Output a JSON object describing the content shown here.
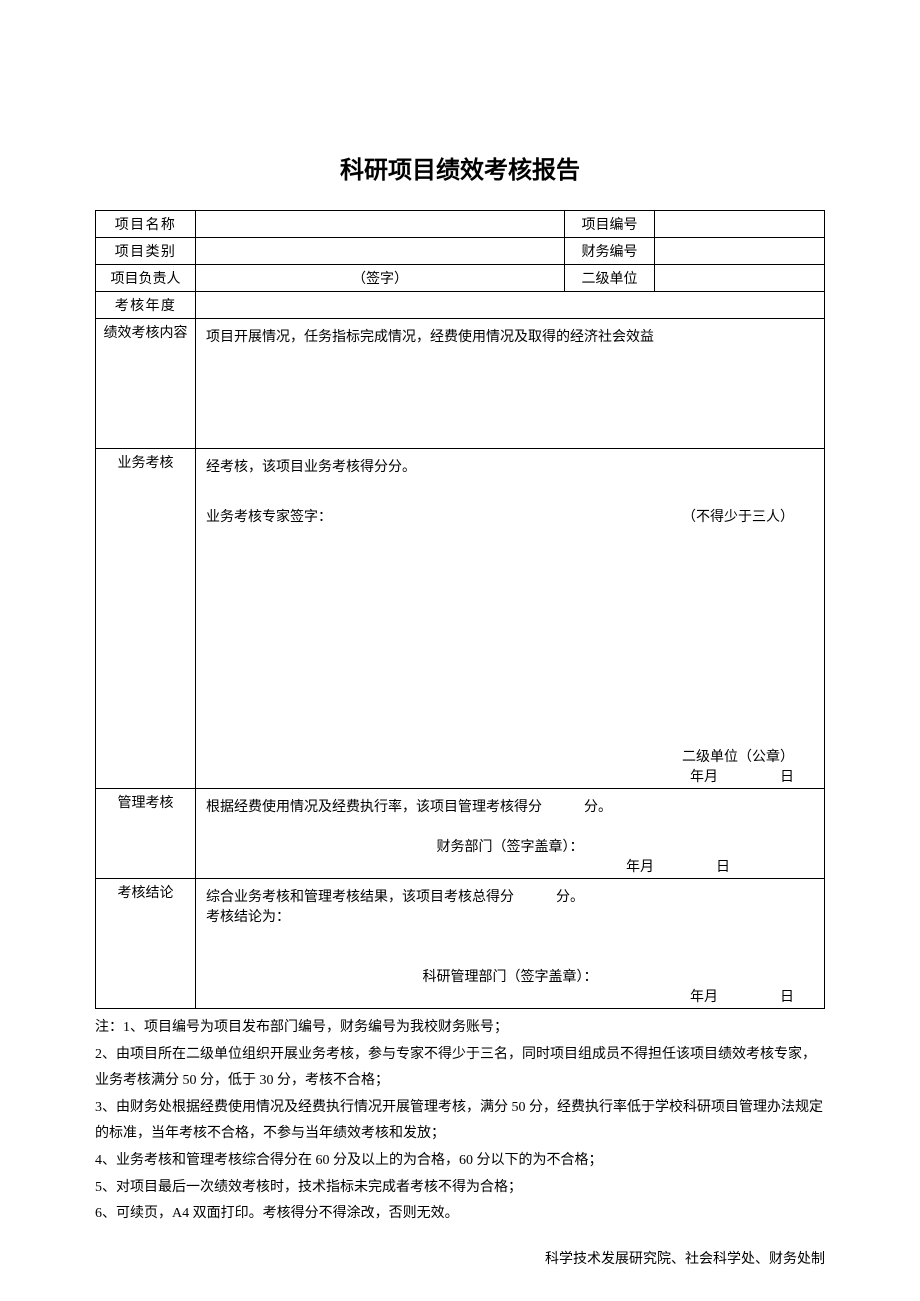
{
  "title": "科研项目绩效考核报告",
  "rows": {
    "r1": {
      "label1": "项目名称",
      "val1": "",
      "label2": "项目编号",
      "val2": ""
    },
    "r2": {
      "label1": "项目类别",
      "val1": "",
      "label2": "财务编号",
      "val2": ""
    },
    "r3": {
      "label1": "项目负责人",
      "val1": "（签字）",
      "label2": "二级单位",
      "val2": ""
    },
    "r4": {
      "label1": "考核年度",
      "val1": ""
    }
  },
  "assessContent": {
    "label": "绩效考核内容",
    "text": "项目开展情况，任务指标完成情况，经费使用情况及取得的经济社会效益"
  },
  "businessAssess": {
    "label": "业务考核",
    "line1": "经考核，该项目业务考核得分分。",
    "line2left": "业务考核专家签字：",
    "line2right": "（不得少于三人）",
    "stamp": "二级单位（公章）",
    "date_ym": "年月",
    "date_d": "日"
  },
  "mgmtAssess": {
    "label": "管理考核",
    "line1": "根据经费使用情况及经费执行率，该项目管理考核得分　　　分。",
    "line2": "财务部门（签字盖章）：",
    "date_ym": "年月",
    "date_d": "日"
  },
  "conclusion": {
    "label": "考核结论",
    "line1": "综合业务考核和管理考核结果，该项目考核总得分　　　分。",
    "line2": "考核结论为：",
    "line3": "科研管理部门（签字盖章）：",
    "date_ym": "年月",
    "date_d": "日"
  },
  "notes": {
    "n1": "注：1、项目编号为项目发布部门编号，财务编号为我校财务账号；",
    "n2": "2、由项目所在二级单位组织开展业务考核，参与专家不得少于三名，同时项目组成员不得担任该项目绩效考核专家，业务考核满分 50 分，低于 30 分，考核不合格；",
    "n3": "3、由财务处根据经费使用情况及经费执行情况开展管理考核，满分 50 分，经费执行率低于学校科研项目管理办法规定的标准，当年考核不合格，不参与当年绩效考核和发放；",
    "n4": "4、业务考核和管理考核综合得分在 60 分及以上的为合格，60 分以下的为不合格；",
    "n5": "5、对项目最后一次绩效考核时，技术指标未完成者考核不得为合格；",
    "n6": "6、可续页，A4 双面打印。考核得分不得涂改，否则无效。"
  },
  "footer": "科学技术发展研究院、社会科学处、财务处制"
}
